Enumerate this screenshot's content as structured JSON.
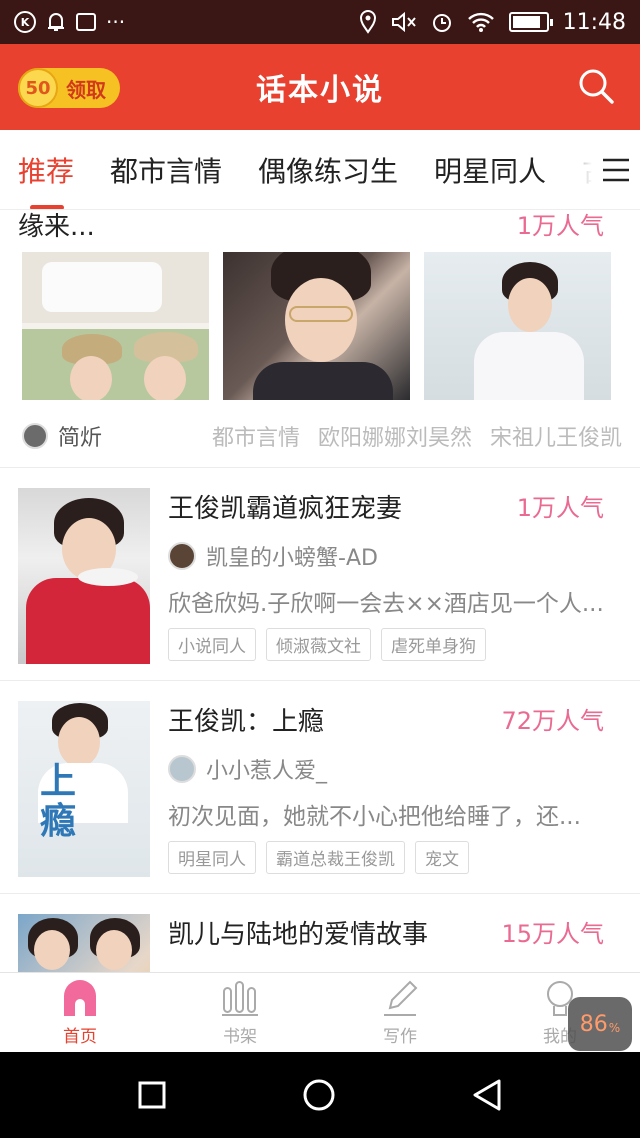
{
  "status_bar": {
    "time": "11:48",
    "left_icons": [
      "k-circle-icon",
      "notification-icon",
      "image-icon",
      "more-dots-icon"
    ],
    "more_text": "···",
    "right_icons": [
      "location-icon",
      "mute-icon",
      "alarm-icon",
      "wifi-icon",
      "battery-icon"
    ]
  },
  "header": {
    "title": "话本小说",
    "coin_value": "50",
    "coin_label": "领取",
    "accent_color": "#e8412f"
  },
  "tabs": {
    "items": [
      "推荐",
      "都市言情",
      "偶像练习生",
      "明星同人",
      "古"
    ],
    "active_index": 0
  },
  "featured": {
    "title": "缘来...",
    "popularity": "1万人气",
    "author": "简炘",
    "tags": [
      "都市言情",
      "欧阳娜娜刘昊然",
      "宋祖儿王俊凯"
    ]
  },
  "books": [
    {
      "title": "王俊凯霸道疯狂宠妻",
      "popularity": "1万人气",
      "author": "凯皇的小螃蟹-AD",
      "description": "欣爸欣妈.子欣啊一会去××酒店见一个人...",
      "tags": [
        "小说同人",
        "倾淑薇文社",
        "虐死单身狗"
      ]
    },
    {
      "title": "王俊凯：上瘾",
      "popularity": "72万人气",
      "author": "小小惹人爱_",
      "description": "初次见面，她就不小心把他给睡了，还...",
      "tags": [
        "明星同人",
        "霸道总裁王俊凯",
        "宠文"
      ],
      "cover_text": "上瘾"
    },
    {
      "title": "凯儿与陆地的爱情故事",
      "popularity": "15万人气"
    }
  ],
  "tabbar": {
    "items": [
      {
        "label": "首页",
        "icon": "home-icon"
      },
      {
        "label": "书架",
        "icon": "bookshelf-icon"
      },
      {
        "label": "写作",
        "icon": "pencil-icon"
      },
      {
        "label": "我的",
        "icon": "profile-icon"
      }
    ],
    "active_index": 0
  },
  "overlay": {
    "percent": "86",
    "percent_sign": "%"
  }
}
